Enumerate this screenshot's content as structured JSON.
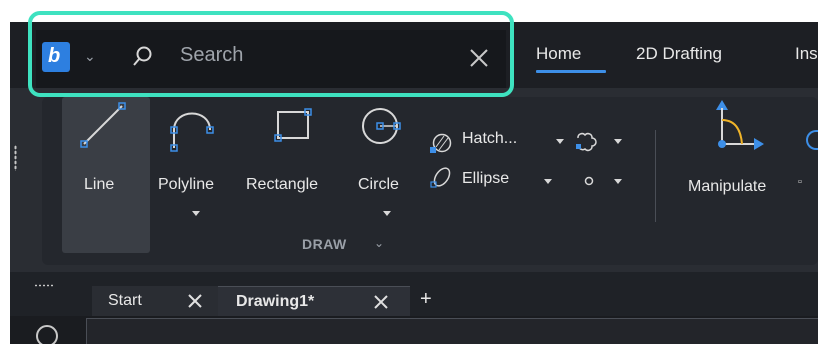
{
  "search": {
    "placeholder": "Search"
  },
  "ribbon_tabs": [
    {
      "label": "Home",
      "active": true
    },
    {
      "label": "2D Drafting"
    },
    {
      "label": "Ins"
    }
  ],
  "draw_panel": {
    "title": "DRAW",
    "tools": {
      "line": "Line",
      "polyline": "Polyline",
      "rectangle": "Rectangle",
      "circle": "Circle",
      "hatch": "Hatch...",
      "ellipse": "Ellipse"
    }
  },
  "modify_panel": {
    "manipulate": "Manipulate"
  },
  "doc_tabs": [
    {
      "label": "Start"
    },
    {
      "label": "Drawing1*",
      "active": true
    }
  ],
  "colors": {
    "accent": "#3d8fe8",
    "highlight": "#3ee2c0",
    "logo": "#2d7fe0"
  },
  "icons": [
    "app-logo-icon",
    "search-icon",
    "close-icon",
    "line-icon",
    "polyline-icon",
    "rectangle-icon",
    "circle-icon",
    "hatch-icon",
    "ellipse-icon",
    "revcloud-icon",
    "point-icon",
    "manipulate-icon",
    "plus-icon"
  ]
}
